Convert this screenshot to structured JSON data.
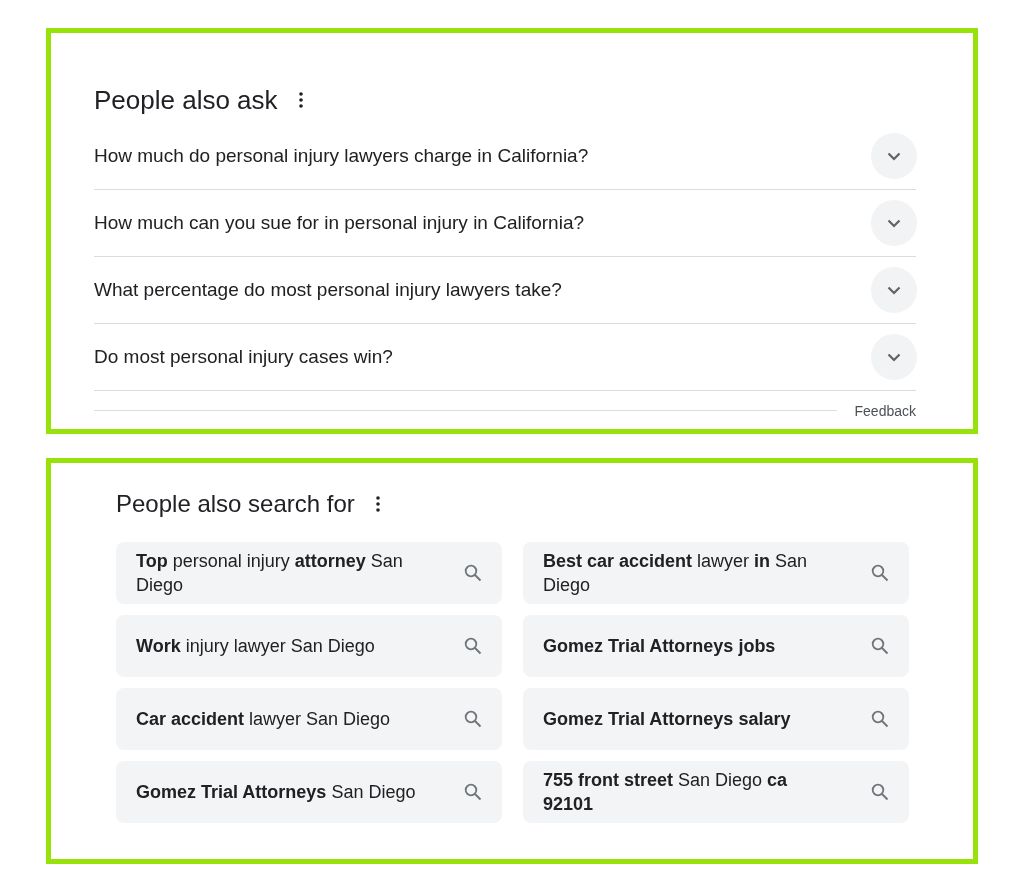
{
  "ask": {
    "title": "People also ask",
    "questions": [
      {
        "text": "How much do personal injury lawyers charge in California?",
        "expanded": false
      },
      {
        "text": "How much can you sue for in personal injury in California?",
        "expanded": false
      },
      {
        "text": "What percentage do most personal injury lawyers take?",
        "expanded": false
      },
      {
        "text": "Do most personal injury cases win?",
        "expanded": false
      }
    ],
    "feedback": "Feedback"
  },
  "search": {
    "title": "People also search for",
    "chips": [
      {
        "text": "**Top** personal injury **attorney** San Diego",
        "bold": false
      },
      {
        "text": "**Work** injury lawyer San Diego",
        "bold": false
      },
      {
        "text": "**Car accident** lawyer San Diego",
        "bold": false
      },
      {
        "text": "**Gomez Trial Attorneys** San Diego",
        "bold": false
      },
      {
        "text": "**Best car accident** lawyer **in** San Diego",
        "bold": false
      },
      {
        "text": "Gomez Trial Attorneys jobs",
        "bold": true
      },
      {
        "text": "Gomez Trial Attorneys salary",
        "bold": true
      },
      {
        "text": "**755 front street** San Diego **ca 92101**",
        "bold": false
      }
    ]
  }
}
